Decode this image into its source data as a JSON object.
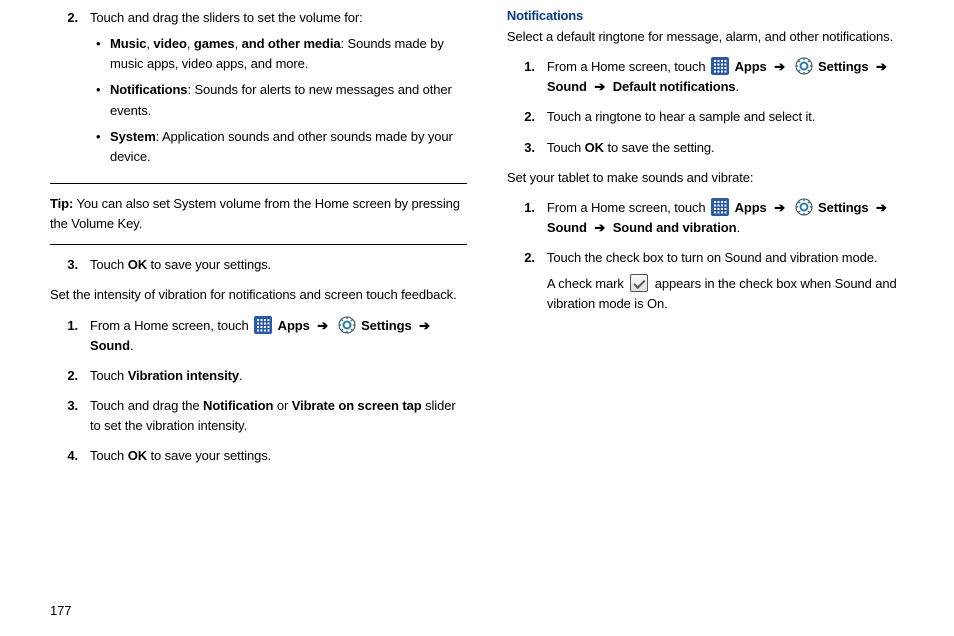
{
  "page_number": "177",
  "left": {
    "step2_intro": "Touch and drag the sliders to set the volume for:",
    "bullets": [
      {
        "bold": "Music",
        "mid": ", ",
        "bold2": "video",
        "mid2": ", ",
        "bold3": "games",
        "mid3": ", ",
        "bold4": "and other media",
        "rest": ": Sounds made by music apps, video apps, and more."
      },
      {
        "bold": "Notifications",
        "rest": ": Sounds for alerts to new messages and other events."
      },
      {
        "bold": "System",
        "rest": ": Application sounds and other sounds made by your device."
      }
    ],
    "tip_label": "Tip:",
    "tip_text": " You can also set System volume from the Home screen by pressing the Volume Key.",
    "step3_pre": "Touch ",
    "step3_bold": "OK",
    "step3_post": " to save your settings.",
    "para_intensity": "Set the intensity of vibration for notifications and screen touch feedback.",
    "vib_step1_pre": "From a Home screen, touch ",
    "apps_label": "Apps",
    "settings_label": "Settings",
    "sound_label": "Sound",
    "vib_step2_pre": "Touch ",
    "vib_step2_bold": "Vibration intensity",
    "vib_step3_pre": "Touch and drag the ",
    "vib_step3_bold1": "Notification",
    "vib_step3_mid": " or ",
    "vib_step3_bold2": "Vibrate on screen tap",
    "vib_step3_post": " slider to set the vibration intensity.",
    "vib_step4_pre": "Touch ",
    "vib_step4_bold": "OK",
    "vib_step4_post": " to save your settings."
  },
  "right": {
    "heading": "Notifications",
    "intro": "Select a default ringtone for message, alarm, and other notifications.",
    "n_step1_pre": "From a Home screen, touch ",
    "apps_label": "Apps",
    "settings_label": "Settings",
    "sound_label": "Sound",
    "default_notif": "Default notifications",
    "n_step2": "Touch a ringtone to hear a sample and select it.",
    "n_step3_pre": "Touch ",
    "n_step3_bold": "OK",
    "n_step3_post": " to save the setting.",
    "para_vibrate": "Set your tablet to make sounds and vibrate:",
    "v_step1_pre": "From a Home screen, touch ",
    "sound_vibration": "Sound and vibration",
    "v_step2": "Touch the check box to turn on Sound and vibration mode.",
    "v_note_pre": "A check mark ",
    "v_note_post": " appears in the check box when Sound and vibration mode is On."
  },
  "numbers": {
    "n1": "1.",
    "n2": "2.",
    "n3": "3.",
    "n4": "4."
  },
  "arrow": "➔"
}
